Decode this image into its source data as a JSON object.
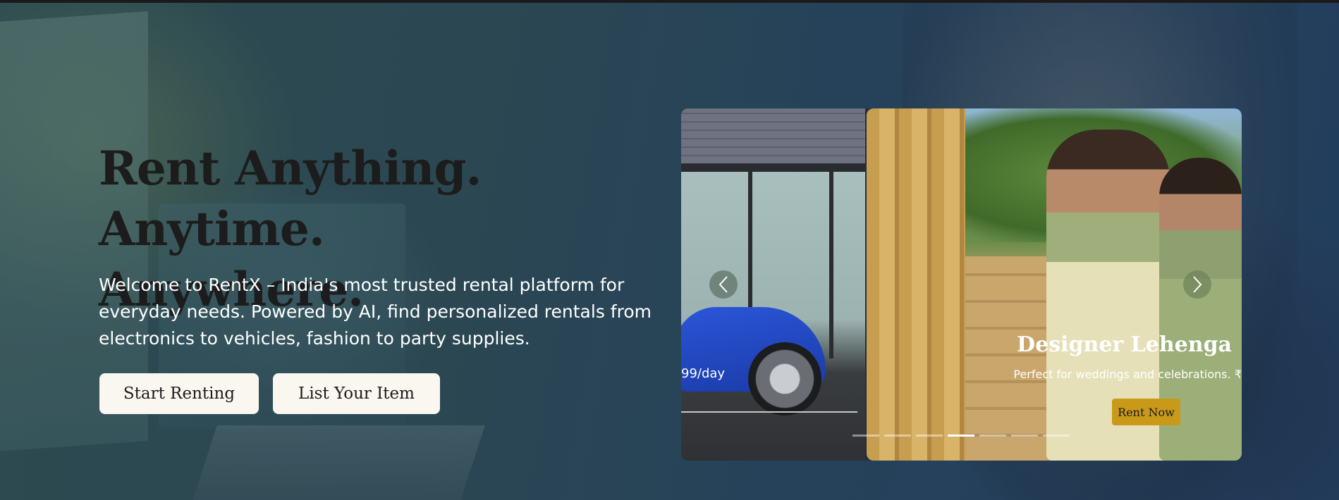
{
  "hero": {
    "headline_line1": "Rent Anything. Anytime.",
    "headline_line2": "Anywhere.",
    "subtext": "Welcome to RentX – India's most trusted rental platform for everyday needs. Powered by AI, find personalized rentals from electronics to vehicles, fashion to party supplies.",
    "buttons": {
      "start_renting": "Start Renting",
      "list_item": "List Your Item"
    }
  },
  "carousel": {
    "previous_slide": {
      "price_fragment": "99/day"
    },
    "active_slide": {
      "title": "Designer Lehenga",
      "description": "Perfect for weddings and celebrations. ₹",
      "cta": "Rent Now"
    },
    "dots_count": 7,
    "active_dot_index": 3
  },
  "colors": {
    "cta_gold": "#c99a1a",
    "button_bg": "#faf6f0",
    "headline_dark": "#1c1c1c",
    "overlay_blue": "#223e5d"
  }
}
